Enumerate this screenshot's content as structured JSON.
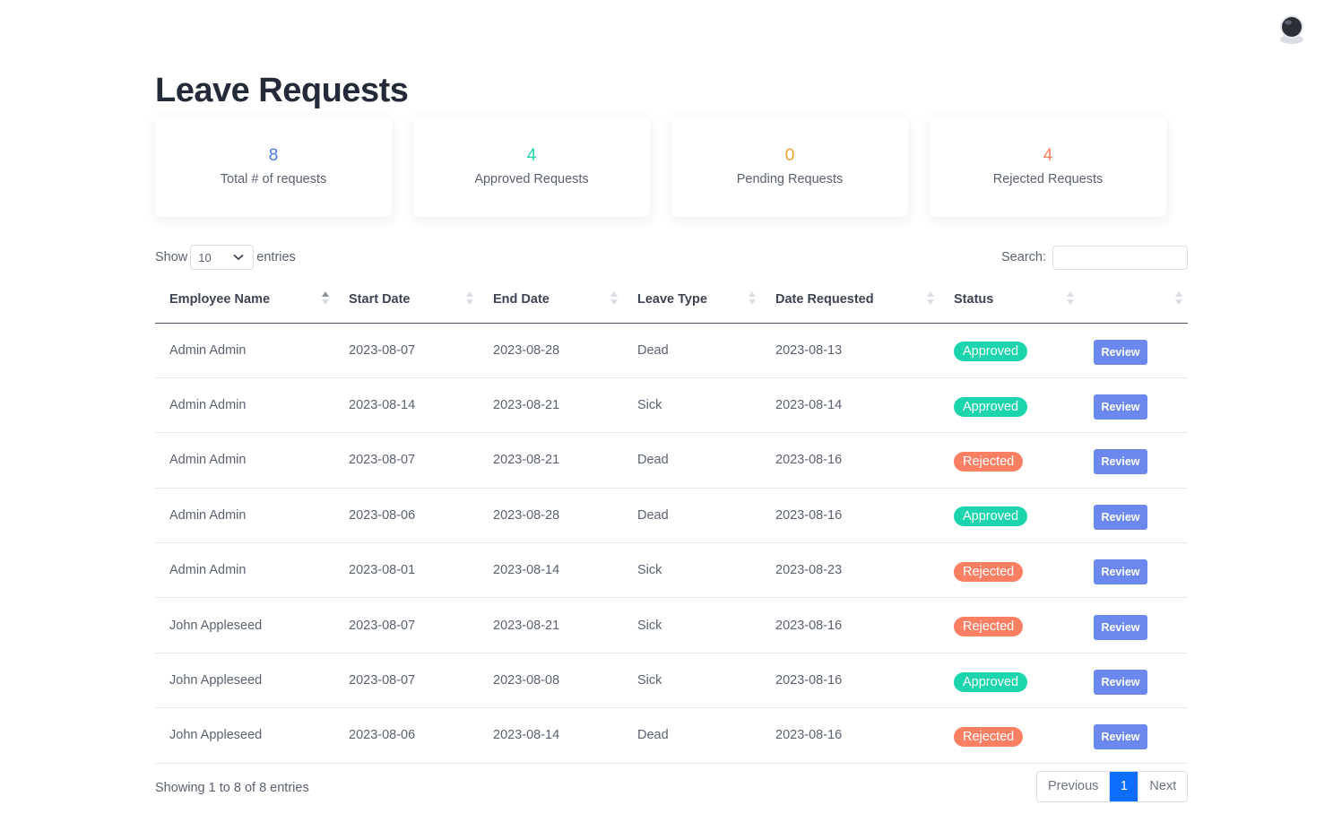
{
  "page": {
    "title": "Leave Requests"
  },
  "stats": [
    {
      "value": "8",
      "label": "Total # of requests",
      "color": "#4a78e8"
    },
    {
      "value": "4",
      "label": "Approved Requests",
      "color": "#1cd5ad"
    },
    {
      "value": "0",
      "label": "Pending Requests",
      "color": "#f0a32e"
    },
    {
      "value": "4",
      "label": "Rejected Requests",
      "color": "#fa7f63"
    }
  ],
  "table_controls": {
    "show_label": "Show",
    "page_size": "10",
    "entries_label": "entries",
    "search_label": "Search:",
    "search_value": ""
  },
  "table": {
    "headers": [
      "Employee Name",
      "Start Date",
      "End Date",
      "Leave Type",
      "Date Requested",
      "Status",
      ""
    ],
    "rows": [
      {
        "name": "Admin Admin",
        "start": "2023-08-07",
        "end": "2023-08-28",
        "type": "Dead",
        "requested": "2023-08-13",
        "status": "Approved",
        "action": "Review"
      },
      {
        "name": "Admin Admin",
        "start": "2023-08-14",
        "end": "2023-08-21",
        "type": "Sick",
        "requested": "2023-08-14",
        "status": "Approved",
        "action": "Review"
      },
      {
        "name": "Admin Admin",
        "start": "2023-08-07",
        "end": "2023-08-21",
        "type": "Dead",
        "requested": "2023-08-16",
        "status": "Rejected",
        "action": "Review"
      },
      {
        "name": "Admin Admin",
        "start": "2023-08-06",
        "end": "2023-08-28",
        "type": "Dead",
        "requested": "2023-08-16",
        "status": "Approved",
        "action": "Review"
      },
      {
        "name": "Admin Admin",
        "start": "2023-08-01",
        "end": "2023-08-14",
        "type": "Sick",
        "requested": "2023-08-23",
        "status": "Rejected",
        "action": "Review"
      },
      {
        "name": "John Appleseed",
        "start": "2023-08-07",
        "end": "2023-08-21",
        "type": "Sick",
        "requested": "2023-08-16",
        "status": "Rejected",
        "action": "Review"
      },
      {
        "name": "John Appleseed",
        "start": "2023-08-07",
        "end": "2023-08-08",
        "type": "Sick",
        "requested": "2023-08-16",
        "status": "Approved",
        "action": "Review"
      },
      {
        "name": "John Appleseed",
        "start": "2023-08-06",
        "end": "2023-08-14",
        "type": "Dead",
        "requested": "2023-08-16",
        "status": "Rejected",
        "action": "Review"
      }
    ]
  },
  "footer": {
    "info": "Showing 1 to 8 of 8 entries",
    "previous": "Previous",
    "current_page": "1",
    "next": "Next"
  },
  "colors": {
    "approved": "#1cd5ad",
    "rejected": "#fa7f63",
    "review_button": "#6a88ee",
    "active_page": "#0d6efd"
  },
  "icons": {
    "avatar": "astronaut-avatar-icon",
    "select_caret": "chevron-down-icon",
    "sort": "sort-arrows-icon"
  }
}
